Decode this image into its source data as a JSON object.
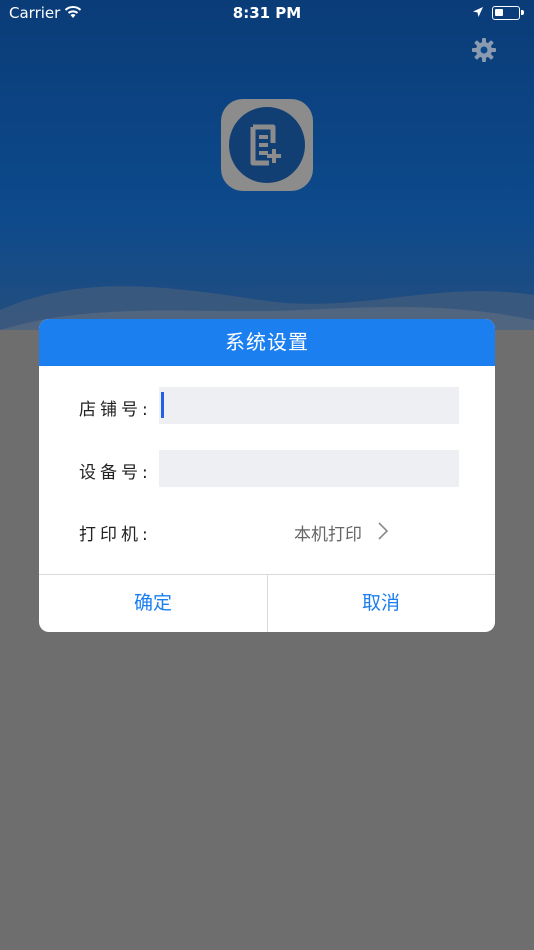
{
  "status_bar": {
    "carrier": "Carrier",
    "time": "8:31 PM"
  },
  "icons": {
    "settings": "gear-icon",
    "app": "document-add-icon",
    "wifi": "wifi-icon",
    "location": "location-arrow-icon",
    "battery": "battery-icon",
    "chevron": "chevron-right-icon"
  },
  "colors": {
    "dialog_header": "#1b7ff0",
    "button_text": "#1b7ff0",
    "input_bg": "#eeeff3",
    "caret": "#2260e8",
    "overlay": "#6e6e6e",
    "bg_top": "#0a3c78"
  },
  "dialog": {
    "title": "系统设置",
    "fields": {
      "store_number": {
        "label": "店铺号:",
        "value": ""
      },
      "device_number": {
        "label": "设备号:",
        "value": ""
      },
      "printer": {
        "label": "打印机:",
        "value": "本机打印"
      }
    },
    "buttons": {
      "confirm": "确定",
      "cancel": "取消"
    }
  }
}
